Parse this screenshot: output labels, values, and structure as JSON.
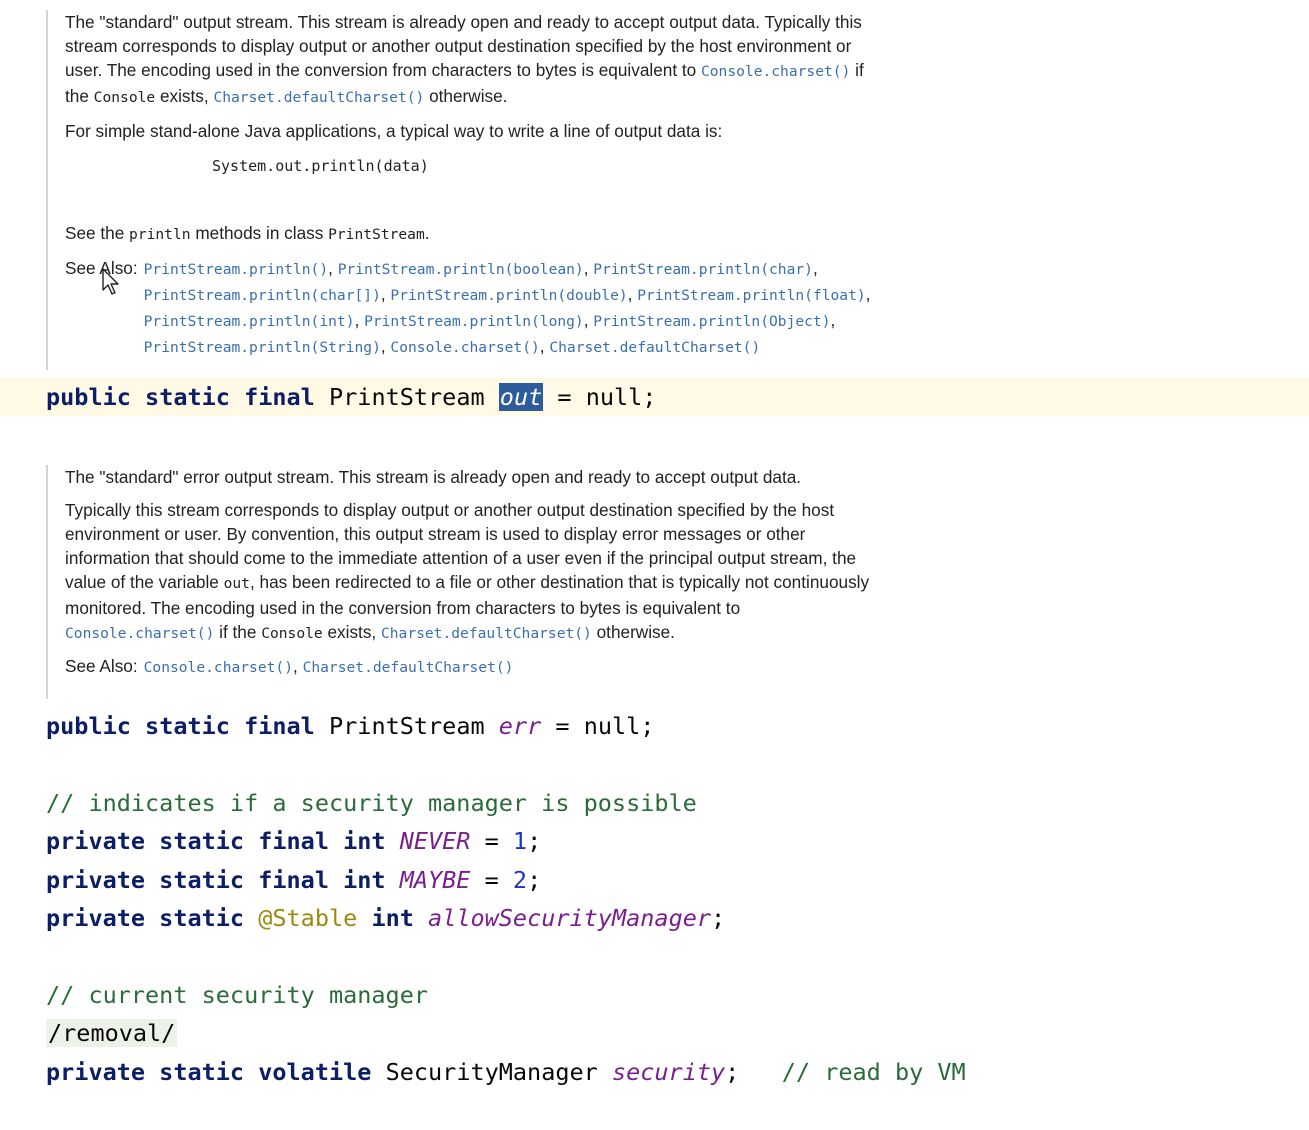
{
  "out_doc": {
    "p1": {
      "text_a": "The \"standard\" output stream. This stream is already open and ready to accept output data. Typically this stream corresponds to display output or another output destination specified by the host environment or user. The encoding used in the conversion from characters to bytes is equivalent to ",
      "link_a": "Console.charset()",
      "text_b": " if the ",
      "code_b": "Console",
      "text_c": " exists, ",
      "link_c": "Charset.defaultCharset()",
      "text_d": " otherwise."
    },
    "p2": "For simple stand-alone Java applications, a typical way to write a line of output data is:",
    "example_code": "System.out.println(data)",
    "p3": {
      "text_a": "See the ",
      "code_a": "println",
      "text_b": " methods in class ",
      "code_b": "PrintStream",
      "text_c": "."
    },
    "see_also_label": "See Also:",
    "see_also_links": [
      "PrintStream.println()",
      "PrintStream.println(boolean)",
      "PrintStream.println(char)",
      "PrintStream.println(char[])",
      "PrintStream.println(double)",
      "PrintStream.println(float)",
      "PrintStream.println(int)",
      "PrintStream.println(long)",
      "PrintStream.println(Object)",
      "PrintStream.println(String)",
      "Console.charset()",
      "Charset.defaultCharset()"
    ]
  },
  "out_decl": {
    "kw1": "public",
    "kw2": "static",
    "kw3": "final",
    "type": "PrintStream",
    "name": "out",
    "rest": " = null;"
  },
  "err_doc": {
    "p1": "The \"standard\" error output stream. This stream is already open and ready to accept output data.",
    "p2": {
      "text_a": "Typically this stream corresponds to display output or another output destination specified by the host environment or user. By convention, this output stream is used to display error messages or other information that should come to the immediate attention of a user even if the principal output stream, the value of the variable ",
      "code_a": "out",
      "text_b": ", has been redirected to a file or other destination that is typically not continuously monitored. The encoding used in the conversion from characters to bytes is equivalent to ",
      "link_b": "Console.charset()",
      "text_c": " if the ",
      "code_c": "Console",
      "text_d": " exists, ",
      "link_d": "Charset.defaultCharset()",
      "text_e": " otherwise."
    },
    "see_also_label": "See Also:",
    "see_also_links": [
      "Console.charset()",
      "Charset.defaultCharset()"
    ]
  },
  "err_decl": {
    "kw1": "public",
    "kw2": "static",
    "kw3": "final",
    "type": "PrintStream",
    "name": "err",
    "rest": " = null;"
  },
  "code": {
    "comment1": "// indicates if a security manager is possible",
    "never": {
      "kw": "private static final int",
      "name": "NEVER",
      "eq": " = ",
      "value": "1",
      "end": ";"
    },
    "maybe": {
      "kw": "private static final int",
      "name": "MAYBE",
      "eq": " = ",
      "value": "2",
      "end": ";"
    },
    "allow": {
      "kw1": "private static",
      "anno": "@Stable",
      "kw2": "int",
      "name": "allowSecurityManager",
      "end": ";"
    },
    "comment2": "// current security manager",
    "removal": "/removal/",
    "security": {
      "kw": "private static volatile",
      "type": "SecurityManager",
      "name": "security",
      "end": ";",
      "comment": "// read by VM"
    }
  },
  "cursor_icon": "arrow-pointer-icon"
}
